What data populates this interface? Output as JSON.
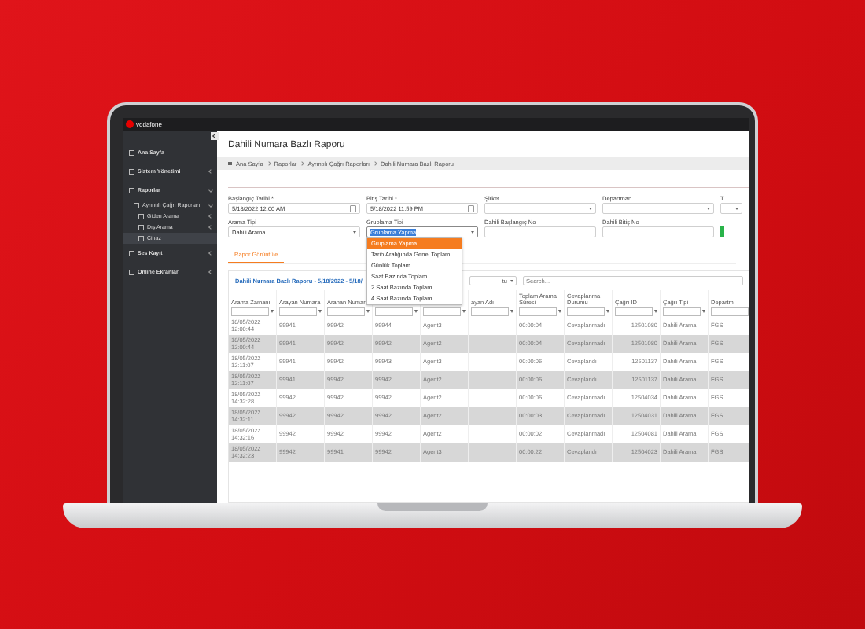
{
  "app": {
    "logo": "vodafone"
  },
  "sidebar": {
    "items": [
      {
        "label": "Ana Sayfa"
      },
      {
        "label": "Sistem Yönetimi",
        "expanded": false
      },
      {
        "label": "Raporlar",
        "expanded": true,
        "children": [
          {
            "label": "Ayrıntılı Çağrı Raporları",
            "expanded": true,
            "children": [
              {
                "label": "Giden Arama",
                "expanded": false
              },
              {
                "label": "Dış Arama",
                "expanded": false
              },
              {
                "label": "Cihaz",
                "selected": true
              }
            ]
          }
        ]
      },
      {
        "label": "Ses Kayıt",
        "expanded": false
      },
      {
        "label": "Online Ekranlar",
        "expanded": false
      }
    ]
  },
  "page": {
    "title": "Dahili Numara Bazlı Raporu",
    "breadcrumb": [
      "Ana Sayfa",
      "Raporlar",
      "Ayrıntılı Çağrı Raporları",
      "Dahili Numara Bazlı Raporu"
    ]
  },
  "filters": [
    {
      "label": "Başlangıç Tarihi *",
      "kind": "date",
      "value": "5/18/2022 12:00 AM"
    },
    {
      "label": "Bitiş Tarihi *",
      "kind": "date",
      "value": "5/18/2022 11:59 PM"
    },
    {
      "label": "Şirket",
      "kind": "select"
    },
    {
      "label": "Departman",
      "kind": "select"
    },
    {
      "label": "T",
      "kind": "select"
    },
    {
      "label": "Arama Tipi",
      "kind": "select",
      "value": "Dahili Arama"
    },
    {
      "label": "Gruplama Tipi",
      "kind": "select",
      "value": "Gruplama Yapma",
      "open": true,
      "options": [
        {
          "label": "Gruplama Yapma",
          "selected": true
        },
        {
          "label": "Tarih Aralığında Genel Toplam",
          "selected": false
        },
        {
          "label": "Günlük Toplam",
          "selected": false
        },
        {
          "label": "Saat Bazında Toplam",
          "selected": false
        },
        {
          "label": "2 Saat Bazında Toplam",
          "selected": false
        },
        {
          "label": "4 Saat Bazında Toplam",
          "selected": false
        }
      ]
    },
    {
      "label": "Dahili Başlangıç No",
      "kind": "text"
    },
    {
      "label": "Dahili Bitiş No",
      "kind": "text"
    },
    {
      "kind": "button"
    }
  ],
  "tabs": [
    {
      "label": "Rapor Görüntüle",
      "selected": true
    }
  ],
  "report": {
    "title": "Dahili Numara Bazlı Raporu - 5/18/2022 - 5/18/",
    "page_size": "tu",
    "search": {
      "placeholder": "Search..."
    }
  },
  "table": {
    "columns": [
      "Arama Zamanı",
      "Arayan Numara",
      "Aranan Numar",
      null,
      null,
      "ayan Adı",
      "Toplam Arama Süresi",
      "Cevaplanma Durumu",
      "Çağrı ID",
      "Çağrı Tipi",
      "Departm"
    ],
    "rows": [
      [
        "18/05/2022 12:00:44",
        "99941",
        "99942",
        "99944",
        "Agent3",
        null,
        "00:00:04",
        "Cevaplanmadı",
        "12501080",
        "Dahili Arama",
        "FGS"
      ],
      [
        "18/05/2022 12:00:44",
        "99941",
        "99942",
        "99942",
        "Agent2",
        null,
        "00:00:04",
        "Cevaplanmadı",
        "12501080",
        "Dahili Arama",
        "FGS"
      ],
      [
        "18/05/2022 12:11:07",
        "99941",
        "99942",
        "99943",
        "Agent3",
        null,
        "00:00:06",
        "Cevaplandı",
        "12501137",
        "Dahili Arama",
        "FGS"
      ],
      [
        "18/05/2022 12:11:07",
        "99941",
        "99942",
        "99942",
        "Agent2",
        null,
        "00:00:06",
        "Cevaplandı",
        "12501137",
        "Dahili Arama",
        "FGS"
      ],
      [
        "18/05/2022 14:32:28",
        "99942",
        "99942",
        "99942",
        "Agent2",
        null,
        "00:00:06",
        "Cevaplanmadı",
        "12504034",
        "Dahili Arama",
        "FGS"
      ],
      [
        "18/05/2022 14:32:11",
        "99942",
        "99942",
        "99942",
        "Agent2",
        null,
        "00:00:03",
        "Cevaplanmadı",
        "12504031",
        "Dahili Arama",
        "FGS"
      ],
      [
        "18/05/2022 14:32:16",
        "99942",
        "99942",
        "99942",
        "Agent2",
        null,
        "00:00:02",
        "Cevaplanmadı",
        "12504081",
        "Dahili Arama",
        "FGS"
      ],
      [
        "18/05/2022 14:32:23",
        "99942",
        "99941",
        "99942",
        "Agent3",
        null,
        "00:00:22",
        "Cevaplandı",
        "12504023",
        "Dahili Arama",
        "FGS"
      ]
    ]
  }
}
